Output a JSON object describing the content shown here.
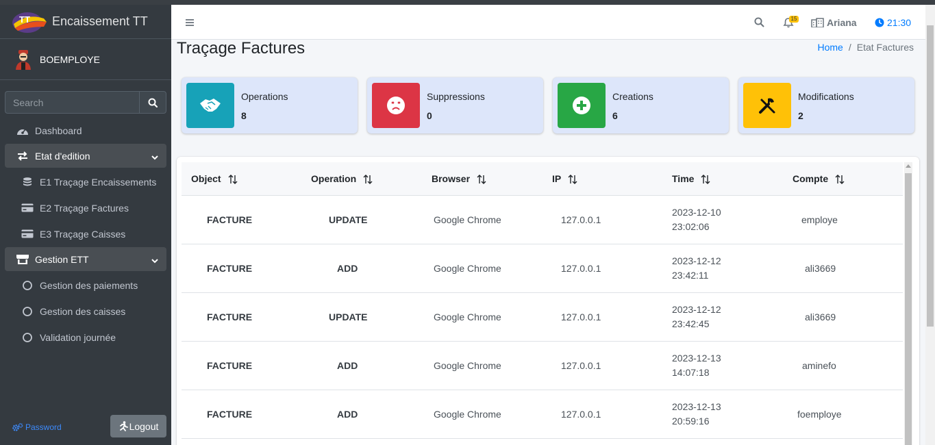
{
  "app": {
    "brand_name": "Encaissement TT"
  },
  "user": {
    "name": "BOEMPLOYE"
  },
  "sidebar": {
    "search_placeholder": "Search",
    "items": [
      {
        "label": "Dashboard",
        "icon": "tachometer-icon"
      },
      {
        "label": "Etat d'edition",
        "icon": "exchange-arrows-icon",
        "expanded": true
      },
      {
        "label": "E1 Traçage Encaissements",
        "icon": "coins-icon"
      },
      {
        "label": "E2 Traçage Factures",
        "icon": "credit-card-icon"
      },
      {
        "label": "E3 Traçage Caisses",
        "icon": "credit-card-icon"
      },
      {
        "label": "Gestion ETT",
        "icon": "store-icon",
        "expanded": true
      },
      {
        "label": "Gestion des paiements",
        "icon": "circle-icon"
      },
      {
        "label": "Gestion des caisses",
        "icon": "circle-icon"
      },
      {
        "label": "Validation journée",
        "icon": "circle-icon"
      }
    ],
    "password_label": "Password",
    "logout_label": "Logout"
  },
  "topbar": {
    "notification_count": "15",
    "location": "Ariana",
    "time": "21:30"
  },
  "page": {
    "title": "Traçage Factures",
    "breadcrumb_home": "Home",
    "breadcrumb_separator": "/",
    "breadcrumb_current": "Etat Factures"
  },
  "stats": [
    {
      "label": "Operations",
      "value": "8",
      "color": "#17a2b8",
      "icon": "handshake-icon"
    },
    {
      "label": "Suppressions",
      "value": "0",
      "color": "#dc3545",
      "icon": "angry-face-icon"
    },
    {
      "label": "Creations",
      "value": "6",
      "color": "#28a745",
      "icon": "plus-circle-icon"
    },
    {
      "label": "Modifications",
      "value": "2",
      "color": "#ffc107",
      "icon": "tools-icon"
    }
  ],
  "table": {
    "columns": [
      "Object",
      "Operation",
      "Browser",
      "IP",
      "Time",
      "Compte"
    ],
    "rows": [
      {
        "object": "FACTURE",
        "operation": "UPDATE",
        "browser": "Google Chrome",
        "ip": "127.0.0.1",
        "date": "2023-12-10",
        "time": "23:02:06",
        "account": "employe"
      },
      {
        "object": "FACTURE",
        "operation": "ADD",
        "browser": "Google Chrome",
        "ip": "127.0.0.1",
        "date": "2023-12-12",
        "time": "23:42:11",
        "account": "ali3669"
      },
      {
        "object": "FACTURE",
        "operation": "UPDATE",
        "browser": "Google Chrome",
        "ip": "127.0.0.1",
        "date": "2023-12-12",
        "time": "23:42:45",
        "account": "ali3669"
      },
      {
        "object": "FACTURE",
        "operation": "ADD",
        "browser": "Google Chrome",
        "ip": "127.0.0.1",
        "date": "2023-12-13",
        "time": "14:07:18",
        "account": "aminefo"
      },
      {
        "object": "FACTURE",
        "operation": "ADD",
        "browser": "Google Chrome",
        "ip": "127.0.0.1",
        "date": "2023-12-13",
        "time": "20:59:16",
        "account": "foemploye"
      }
    ]
  }
}
